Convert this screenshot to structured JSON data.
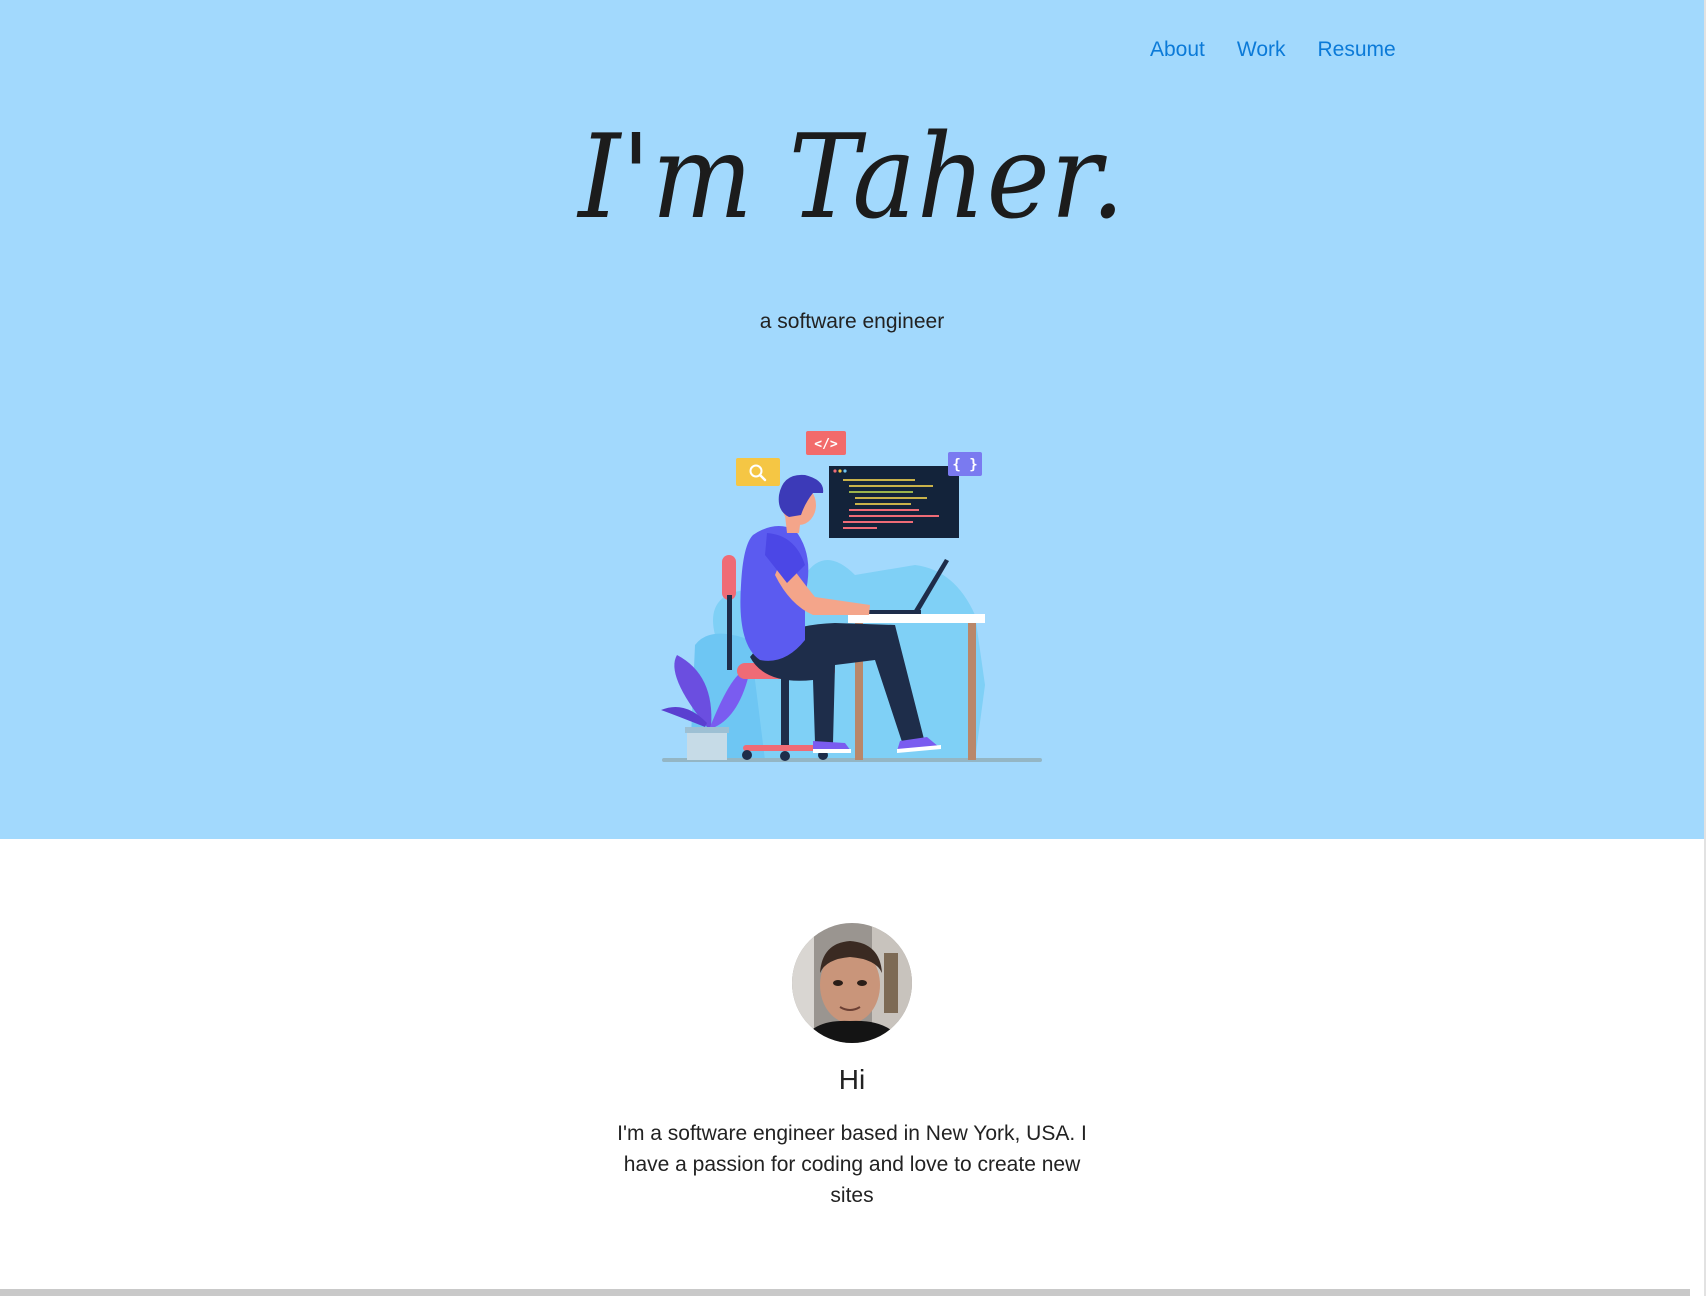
{
  "nav": {
    "items": [
      {
        "label": "About"
      },
      {
        "label": "Work"
      },
      {
        "label": "Resume"
      }
    ]
  },
  "hero": {
    "title": "I'm Taher.",
    "subtitle": "a software engineer",
    "background_color": "#a2d9fd",
    "illustration_badges": {
      "code": "</>",
      "braces": "{ }"
    }
  },
  "about": {
    "heading": "Hi",
    "text": "I'm a software engineer based in New York, USA. I have a passion for coding and love to create new sites"
  },
  "colors": {
    "link": "#0b7ad8",
    "text": "#222222",
    "hero_bg": "#a2d9fd"
  }
}
